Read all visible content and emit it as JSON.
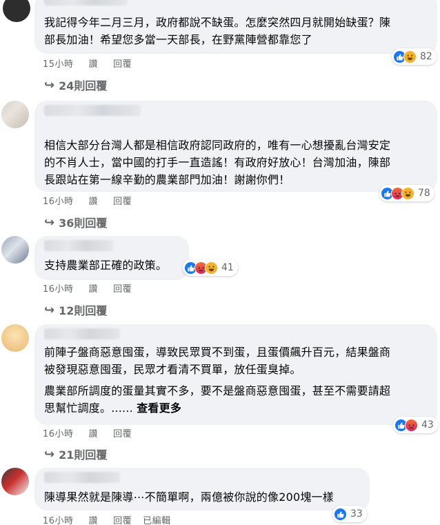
{
  "comments": [
    {
      "paragraphs": [
        "我記得今年二月三月，政府都說不缺蛋。怎麼突然四月就開始缺蛋？陳\n部長加油！希望您多當一天部長，在野黨陣營都靠您了"
      ],
      "reactions": [
        "like-icon",
        "haha-icon"
      ],
      "reaction_count": "82",
      "time": "15小時",
      "like_label": "讚",
      "reply_label": "回覆",
      "replies_label": "24則回覆"
    },
    {
      "paragraphs": [
        "相信大部分台灣人都是相信政府認同政府的，唯有一心想擾亂台灣安定\n的不肖人士，當中國的打手一直造謠！有政府好放心！台灣加油，陳部\n長跟站在第一線辛勤的農業部門加油！謝謝你們！"
      ],
      "reactions": [
        "like-icon",
        "angry-icon",
        "haha-icon"
      ],
      "reaction_count": "78",
      "time": "16小時",
      "like_label": "讚",
      "reply_label": "回覆",
      "replies_label": "36則回覆"
    },
    {
      "paragraphs": [
        "支持農業部正確的政策。"
      ],
      "reactions": [
        "like-icon",
        "angry-icon",
        "haha-icon"
      ],
      "reaction_count": "41",
      "time": "16小時",
      "like_label": "讚",
      "reply_label": "回覆",
      "replies_label": "12則回覆"
    },
    {
      "paragraphs": [
        "前陣子盤商惡意囤蛋，導致民眾買不到蛋，且蛋價飆升百元，結果盤商\n被發現惡意囤蛋，民眾才看清不買單，放任蛋臭掉。",
        "農業部所調度的蛋量其實不多，要不是盤商惡意囤蛋，甚至不需要請超\n思幫忙調度。......"
      ],
      "see_more": "查看更多",
      "reactions": [
        "like-icon",
        "angry-icon"
      ],
      "reaction_count": "43",
      "time": "16小時",
      "like_label": "讚",
      "reply_label": "回覆",
      "replies_label": "21則回覆"
    },
    {
      "paragraphs": [
        "陳導果然就是陳導⋯不簡單啊，兩億被你說的像200塊一樣"
      ],
      "reactions": [
        "like-icon"
      ],
      "reaction_count": "33",
      "time": "16小時",
      "like_label": "讚",
      "reply_label": "回覆",
      "edited_label": "已編輯"
    }
  ]
}
